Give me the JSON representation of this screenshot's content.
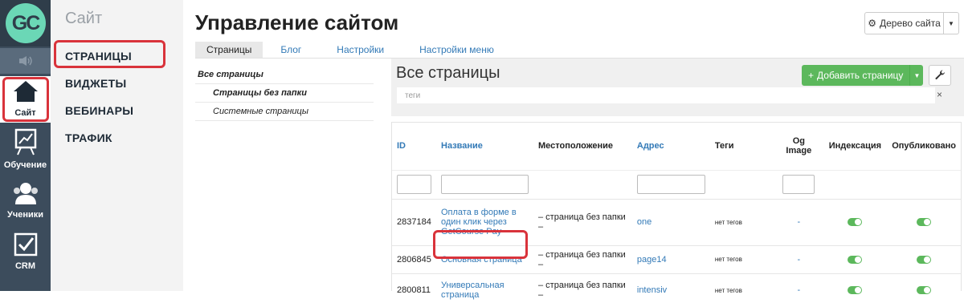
{
  "logo": {
    "text": "GC"
  },
  "rail": {
    "items": [
      {
        "label": "Сайт",
        "icon": "house-icon"
      },
      {
        "label": "Обучение",
        "icon": "chart-board-icon"
      },
      {
        "label": "Ученики",
        "icon": "people-icon"
      },
      {
        "label": "CRM",
        "icon": "checkbox-icon"
      }
    ]
  },
  "sidemenu": {
    "title": "Сайт",
    "items": [
      "СТРАНИЦЫ",
      "ВИДЖЕТЫ",
      "ВЕБИНАРЫ",
      "ТРАФИК"
    ]
  },
  "header": {
    "title": "Управление сайтом",
    "tree_button": "Дерево сайта"
  },
  "tabs": [
    "Страницы",
    "Блог",
    "Настройки",
    "Настройки меню"
  ],
  "folders": [
    "Все страницы",
    "Страницы без папки",
    "Системные страницы"
  ],
  "panel": {
    "title": "Все страницы",
    "add_button": "Добавить страницу",
    "tags_placeholder": "теги",
    "tags_clear": "×"
  },
  "table": {
    "headers": {
      "id": "ID",
      "name": "Название",
      "location": "Местоположение",
      "address": "Адрес",
      "tags": "Теги",
      "og1": "Og",
      "og2": "Image",
      "indexing": "Индексация",
      "published": "Опубликовано"
    },
    "rows": [
      {
        "id": "2837184",
        "name": "Оплата в форме в один клик через GetCourse Pay",
        "location": "– страница без папки –",
        "address": "one",
        "tags": "нет тегов",
        "og": "-",
        "indexing": true,
        "published": true
      },
      {
        "id": "2806845",
        "name": "Основная страница",
        "location": "– страница без папки –",
        "address": "page14",
        "tags": "нет тегов",
        "og": "-",
        "indexing": true,
        "published": true
      },
      {
        "id": "2800811",
        "name": "Универсальная страница",
        "location": "– страница без папки –",
        "address": "intensiv",
        "tags": "нет тегов",
        "og": "-",
        "indexing": true,
        "published": true
      }
    ]
  },
  "colors": {
    "rail": "#3c4c5c",
    "accent": "#337ab7",
    "success": "#5cb85c",
    "highlight": "#d9333b",
    "logo": "#6bd7b6"
  }
}
